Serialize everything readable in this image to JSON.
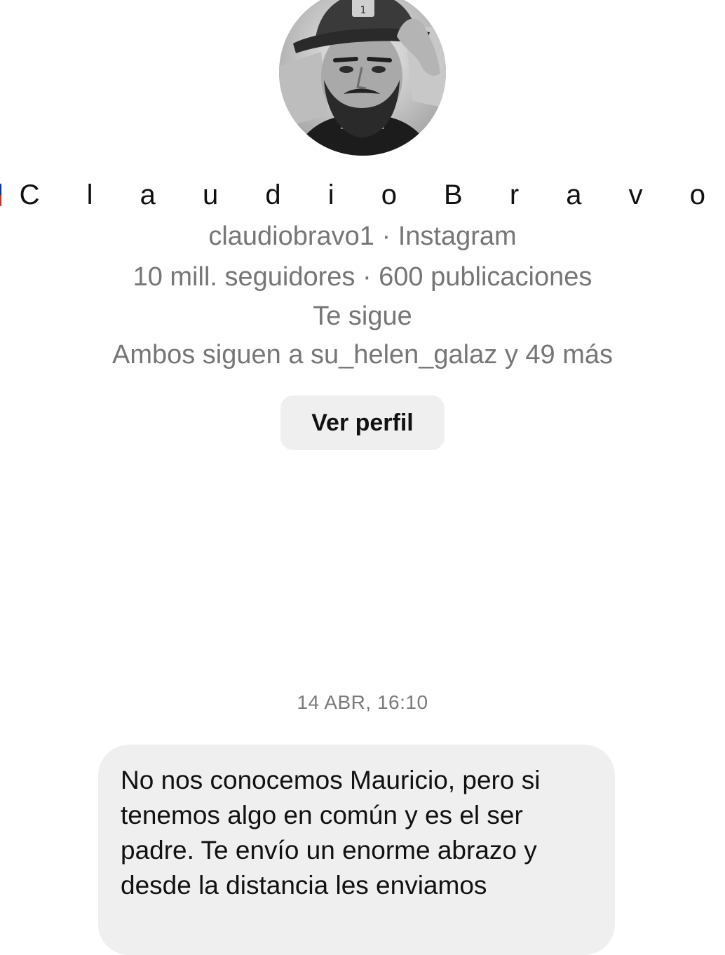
{
  "profile": {
    "flag_emoji": "🇨🇱",
    "display_name": "C l a u d i o B r a v o",
    "handle_line": "claudiobravo1 · Instagram",
    "stats_line": "10 mill. seguidores · 600 publicaciones",
    "follows_you": "Te sigue",
    "mutual_line": "Ambos siguen a su_helen_galaz y 49 más",
    "view_profile_label": "Ver perfil"
  },
  "thread": {
    "timestamp": "14 ABR, 16:10",
    "messages": [
      {
        "text": "No nos conocemos Mauricio, pero si tenemos algo en común y es el ser padre. Te envío un enorme abrazo y desde la distancia les enviamos"
      }
    ]
  },
  "colors": {
    "secondary_text": "#767676",
    "bubble_bg": "#efefef",
    "button_bg": "#efefef",
    "flag_red": "#d52b1e",
    "flag_blue": "#0039a6",
    "flag_white": "#ffffff"
  }
}
